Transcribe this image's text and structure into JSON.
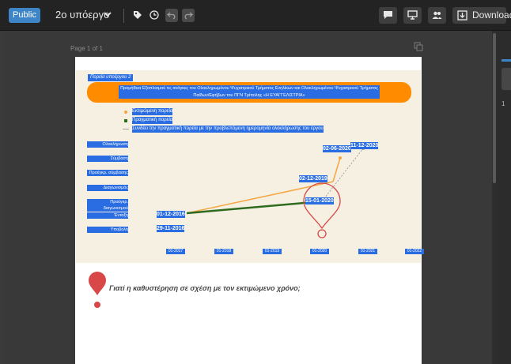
{
  "toolbar": {
    "visibility_label": "Public",
    "project_title": "2ο υπόεργο",
    "download_label": "Download",
    "icons": [
      "chevron-down-icon",
      "tag-icon",
      "history-icon",
      "undo-icon",
      "redo-icon",
      "comment-icon",
      "present-icon",
      "share-users-icon",
      "download-icon"
    ]
  },
  "viewer": {
    "page_indicator": "Page 1 of 1",
    "thumbnail_number": "1"
  },
  "slide": {
    "corner_label": "Πορεία υποέργου 2",
    "banner_title": "Προμήθεια Εξοπλισμού τις ανάγκες του Ολοκληρωμένου Ψυχιατρικού Τμήματος Ενηλίκων και Ολοκληρωμένου Ψυχιατρικού Τμήματος Παίδων/Εφήβων του ΠΓΝ Τρίπολης «Η ΕΥΑΓΓΕΛΙΣΤΡΙΑ»",
    "question": "Γιατί η καθυστέρηση σε σχέση με τον εκτιμώμενο χρόνο;",
    "colors": {
      "banner": "#ff8c00",
      "label_bg": "#2a6de3",
      "estimated": "#f5a640",
      "actual": "#2e6b1e",
      "projection": "#a0a0a0",
      "marker": "#d94848"
    }
  },
  "chart_data": {
    "type": "line",
    "legend": [
      {
        "name": "Εκτιμώμενη πορεία",
        "color": "#f5a640"
      },
      {
        "name": "Πραγματική πορεία",
        "color": "#2e6b1e"
      },
      {
        "name": "Συνδέει την πραγματική πορεία με την προβλεπόμενη ημερομηνία ολοκλήρωσης του έργου",
        "color": "#a0a0a0"
      }
    ],
    "y_categories": [
      "Υποβολή",
      "Ένταξη",
      "Προέγκρ. διαγωνισμού",
      "Διαγωνισμός",
      "Προέγκρ. σύμβασης",
      "Σύμβαση",
      "Ολοκλήρωση"
    ],
    "x_ticks": [
      "01-2017",
      "01-2018",
      "01-2019",
      "01-2020",
      "01-2021",
      "01-2022"
    ],
    "point_labels": [
      {
        "label": "29-11-2016",
        "date": "2016-11-29",
        "stage": "Υποβολή"
      },
      {
        "label": "01-12-2016",
        "date": "2016-12-01",
        "stage": "Ένταξη"
      },
      {
        "label": "15-01-2020",
        "date": "2020-01-15",
        "stage": "Προέγκρ. διαγωνισμού"
      },
      {
        "label": "02-12-2019",
        "date": "2019-12-02",
        "stage": "Προέγκρ. σύμβασης"
      },
      {
        "label": "02-06-2020",
        "date": "2020-06-02",
        "stage": "Ολοκλήρωση"
      },
      {
        "label": "11-12-2020",
        "date": "2020-12-11",
        "stage": "Ολοκλήρωση"
      }
    ],
    "series": [
      {
        "name": "Εκτιμώμενη πορεία",
        "points": [
          {
            "x": "2016-12-01",
            "y": "Ένταξη"
          },
          {
            "x": "2019-12-02",
            "y": "Προέγκρ. σύμβασης"
          },
          {
            "x": "2020-06-02",
            "y": "Ολοκλήρωση"
          }
        ]
      },
      {
        "name": "Πραγματική πορεία",
        "points": [
          {
            "x": "2016-12-01",
            "y": "Ένταξη"
          },
          {
            "x": "2020-01-15",
            "y": "Προέγκρ. διαγωνισμού"
          }
        ]
      },
      {
        "name": "Συνδέει την πραγματική πορεία με την προβλεπόμενη ημερομηνία ολοκλήρωσης του έργου",
        "points": [
          {
            "x": "2020-01-15",
            "y": "Προέγκρ. διαγωνισμού"
          },
          {
            "x": "2020-12-11",
            "y": "Ολοκλήρωση"
          }
        ]
      }
    ],
    "xlim": [
      "2016-11-01",
      "2022-02-01"
    ]
  }
}
